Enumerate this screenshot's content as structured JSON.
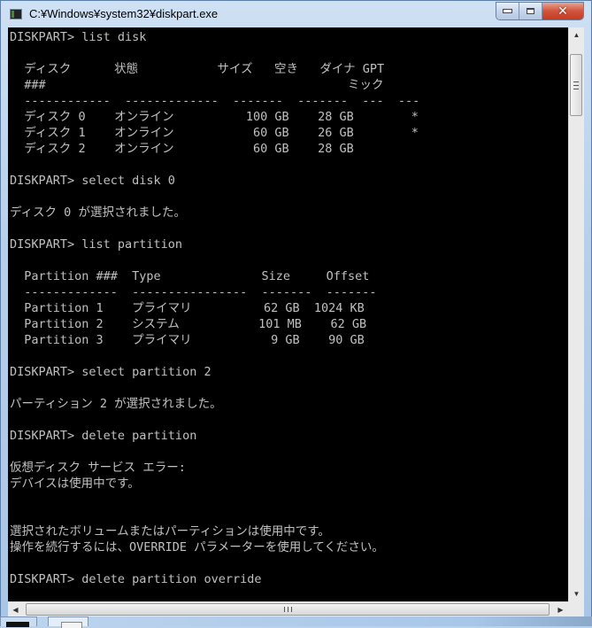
{
  "window": {
    "title": "C:¥Windows¥system32¥diskpart.exe",
    "icon": "console-app-icon",
    "buttons": {
      "minimize": "minimize-icon",
      "maximize": "maximize-icon",
      "close": "✕"
    }
  },
  "console": {
    "lines": [
      "DISKPART> list disk",
      "",
      "  ディスク      状態           サイズ   空き   ダイナ GPT",
      "  ###                                          ミック",
      "  ------------  -------------  -------  -------  ---  ---",
      "  ディスク 0    オンライン          100 GB    28 GB        *",
      "  ディスク 1    オンライン           60 GB    26 GB        *",
      "  ディスク 2    オンライン           60 GB    28 GB",
      "",
      "DISKPART> select disk 0",
      "",
      "ディスク 0 が選択されました。",
      "",
      "DISKPART> list partition",
      "",
      "  Partition ###  Type              Size     Offset",
      "  -------------  ----------------  -------  -------",
      "  Partition 1    プライマリ          62 GB  1024 KB",
      "  Partition 2    システム           101 MB    62 GB",
      "  Partition 3    プライマリ           9 GB    90 GB",
      "",
      "DISKPART> select partition 2",
      "",
      "パーティション 2 が選択されました。",
      "",
      "DISKPART> delete partition",
      "",
      "仮想ディスク サービス エラー:",
      "デバイスは使用中です。",
      "",
      "",
      "選択されたボリュームまたはパーティションは使用中です。",
      "操作を続行するには、OVERRIDE パラメーターを使用してください。",
      "",
      "DISKPART> delete partition override"
    ],
    "disk_table": {
      "headers": [
        "ディスク ###",
        "状態",
        "サイズ",
        "空き",
        "ダイナミック",
        "GPT"
      ],
      "rows": [
        [
          "ディスク 0",
          "オンライン",
          "100 GB",
          "28 GB",
          "",
          "*"
        ],
        [
          "ディスク 1",
          "オンライン",
          "60 GB",
          "26 GB",
          "",
          "*"
        ],
        [
          "ディスク 2",
          "オンライン",
          "60 GB",
          "28 GB",
          "",
          ""
        ]
      ]
    },
    "partition_table": {
      "headers": [
        "Partition ###",
        "Type",
        "Size",
        "Offset"
      ],
      "rows": [
        [
          "Partition 1",
          "プライマリ",
          "62 GB",
          "1024 KB"
        ],
        [
          "Partition 2",
          "システム",
          "101 MB",
          "62 GB"
        ],
        [
          "Partition 3",
          "プライマリ",
          "9 GB",
          "90 GB"
        ]
      ]
    }
  },
  "scrollbars": {
    "up": "▲",
    "down": "▼",
    "left": "◀",
    "right": "▶"
  }
}
